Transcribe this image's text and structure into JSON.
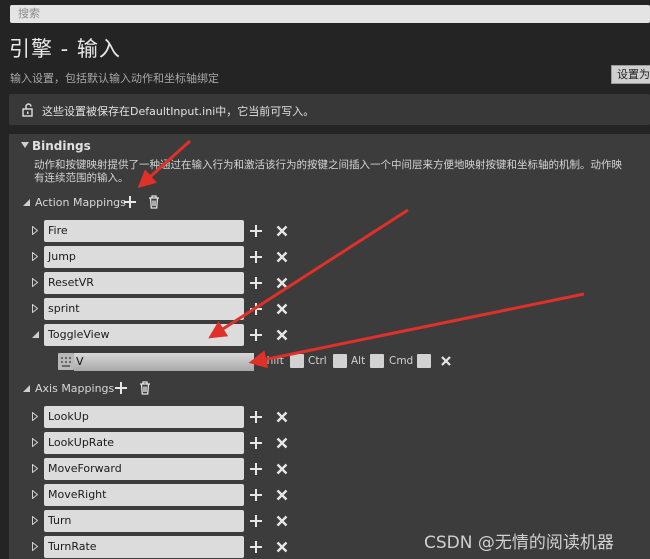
{
  "search": {
    "placeholder": "搜索"
  },
  "header": {
    "title": "引擎 - 输入",
    "subtitle": "输入设置，包括默认输入动作和坐标轴绑定",
    "set_default_label": "设置为"
  },
  "info": {
    "text": "这些设置被保存在DefaultInput.ini中，它当前可写入。"
  },
  "bindings": {
    "title": "Bindings",
    "desc_line1": "动作和按键映射提供了一种通过在输入行为和激活该行为的按键之间插入一个中间层来方便地映射按键和坐标轴的机制。动作映",
    "desc_line2": "有连续范围的输入。"
  },
  "action_mappings": {
    "label": "Action Mappings",
    "items": [
      "Fire",
      "Jump",
      "ResetVR",
      "sprint",
      "ToggleView"
    ],
    "expanded": "ToggleView",
    "key": {
      "value": "V",
      "modifiers": [
        "Shift",
        "Ctrl",
        "Alt",
        "Cmd"
      ]
    }
  },
  "axis_mappings": {
    "label": "Axis Mappings",
    "items": [
      "LookUp",
      "LookUpRate",
      "MoveForward",
      "MoveRight",
      "Turn",
      "TurnRate"
    ]
  },
  "watermark": "CSDN @无情的阅读机器",
  "colors": {
    "annotation_arrow": "#e0302a",
    "background": "#242424",
    "panel": "#3c3c3c"
  }
}
